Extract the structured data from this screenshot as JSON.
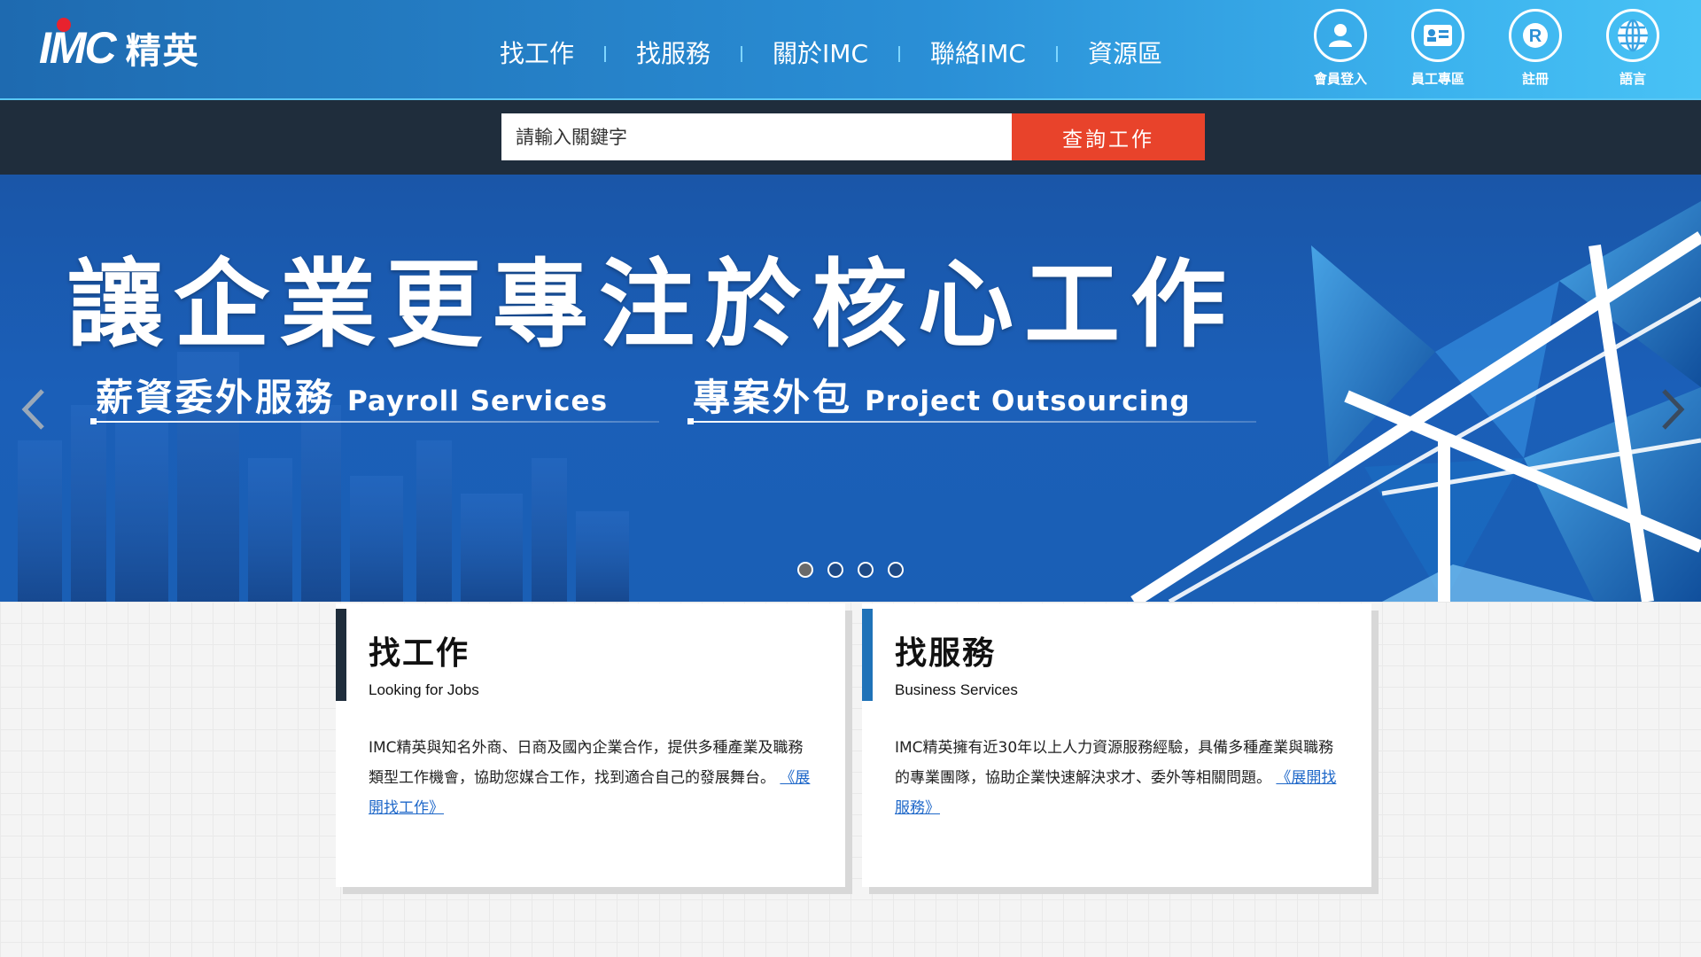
{
  "header": {
    "logo_mark": "IMC",
    "logo_text": "精英",
    "nav": [
      {
        "label": "找工作"
      },
      {
        "label": "找服務"
      },
      {
        "label": "關於IMC"
      },
      {
        "label": "聯絡IMC"
      },
      {
        "label": "資源區"
      }
    ],
    "icons": [
      {
        "label": "會員登入",
        "icon": "user-icon"
      },
      {
        "label": "員工專區",
        "icon": "id-card-icon"
      },
      {
        "label": "註冊",
        "icon": "registered-icon"
      },
      {
        "label": "語言",
        "icon": "globe-icon"
      }
    ]
  },
  "search": {
    "placeholder": "請輸入關鍵字",
    "button_label": "查詢工作"
  },
  "banner": {
    "title": "讓企業更專注於核心工作",
    "sub1_zh": "薪資委外服務",
    "sub1_en": "Payroll Services",
    "sub2_zh": "專案外包",
    "sub2_en": "Project Outsourcing",
    "slide_count": 4,
    "active_slide": 1
  },
  "cards": [
    {
      "title": "找工作",
      "subtitle": "Looking for Jobs",
      "desc": "IMC精英與知名外商、日商及國內企業合作，提供多種產業及職務類型工作機會，協助您媒合工作，找到適合自己的發展舞台。",
      "link": "《展開找工作》",
      "accent": "#1f2d3c"
    },
    {
      "title": "找服務",
      "subtitle": "Business Services",
      "desc": "IMC精英擁有近30年以上人力資源服務經驗，具備多種產業與職務的專業團隊，協助企業快速解決求才、委外等相關問題。",
      "link": "《展開找服務》",
      "accent": "#1f72b8"
    }
  ],
  "colors": {
    "header_start": "#1e6ab0",
    "header_end": "#48c2f5",
    "search_bg": "#1f2d3c",
    "search_button": "#e8432b",
    "link": "#1f68c9"
  }
}
